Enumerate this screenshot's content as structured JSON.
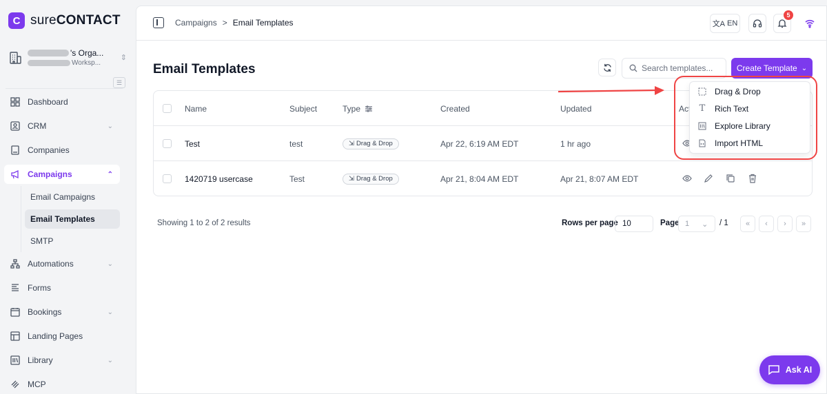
{
  "brand": {
    "prefix": "sure",
    "name": "CONTACT",
    "logo_letter": "C",
    "color": "#7c3aed"
  },
  "org": {
    "name_suffix": "'s Orga...",
    "workspace_suffix": "Worksp..."
  },
  "sidebar": {
    "items": [
      {
        "label": "Dashboard",
        "icon": "grid-icon"
      },
      {
        "label": "CRM",
        "icon": "contact-card-icon"
      },
      {
        "label": "Companies",
        "icon": "building-icon"
      },
      {
        "label": "Campaigns",
        "icon": "megaphone-icon"
      },
      {
        "label": "Automations",
        "icon": "flow-icon"
      },
      {
        "label": "Forms",
        "icon": "form-icon"
      },
      {
        "label": "Bookings",
        "icon": "calendar-icon"
      },
      {
        "label": "Landing Pages",
        "icon": "layout-icon"
      },
      {
        "label": "Library",
        "icon": "library-icon"
      },
      {
        "label": "MCP",
        "icon": "mcp-icon"
      }
    ],
    "sub_items": [
      "Email Campaigns",
      "Email Templates",
      "SMTP"
    ],
    "active_item": "Campaigns",
    "active_sub_item": "Email Templates"
  },
  "topbar": {
    "breadcrumb": [
      "Campaigns",
      "Email Templates"
    ],
    "separator": ">",
    "language": "EN",
    "notification_count": "5"
  },
  "page": {
    "title": "Email Templates",
    "search_placeholder": "Search templates...",
    "create_button": "Create Template"
  },
  "table": {
    "columns": [
      "Name",
      "Subject",
      "Type",
      "Created",
      "Updated",
      "Act"
    ],
    "rows": [
      {
        "name": "Test",
        "subject": "test",
        "type": "Drag & Drop",
        "created": "Apr 22, 6:19 AM EDT",
        "updated": "1 hr ago"
      },
      {
        "name": "1420719 usercase",
        "subject": "Test",
        "type": "Drag & Drop",
        "created": "Apr 21, 8:04 AM EDT",
        "updated": "Apr 21, 8:07 AM EDT"
      }
    ]
  },
  "pagination": {
    "summary": "Showing 1 to 2 of 2 results",
    "rows_per_page_label": "Rows per page",
    "rows_per_page": "10",
    "page_label": "Page",
    "page_value": "1",
    "page_of": "/ 1",
    "first": "«",
    "prev": "‹",
    "next": "›",
    "last": "»"
  },
  "dropdown": {
    "items": [
      {
        "label": "Drag & Drop",
        "icon": "dashed-square-icon"
      },
      {
        "label": "Rich Text",
        "icon": "text-t-icon"
      },
      {
        "label": "Explore Library",
        "icon": "library-icon"
      },
      {
        "label": "Import HTML",
        "icon": "html-file-icon"
      }
    ]
  },
  "ask_ai": {
    "label": "Ask AI"
  },
  "colors": {
    "accent": "#7c3aed",
    "annotation": "#ef4444"
  }
}
